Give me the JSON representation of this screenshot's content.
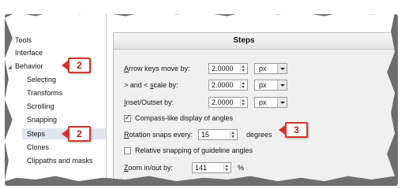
{
  "nav": {
    "items": [
      {
        "label": "Tools"
      },
      {
        "label": "Interface"
      },
      {
        "label": "Behavior"
      },
      {
        "label": "Selecting"
      },
      {
        "label": "Transforms"
      },
      {
        "label": "Scrolling"
      },
      {
        "label": "Snapping"
      },
      {
        "label": "Steps"
      },
      {
        "label": "Clones"
      },
      {
        "label": "Clippaths and masks"
      }
    ],
    "selected": "Steps",
    "expanded": "Behavior"
  },
  "page": {
    "title": "Steps",
    "arrow_keys": {
      "label_first": "A",
      "label_rest": "rrow keys move by:",
      "value": "2.0000",
      "unit": "px"
    },
    "scale": {
      "label_pre": "> and < ",
      "label_ul": "s",
      "label_post": "cale by:",
      "value": "2.0000",
      "unit": "px"
    },
    "inset": {
      "label_first": "I",
      "label_rest": "nset/Outset by:",
      "value": "2.0000",
      "unit": "px"
    },
    "compass": {
      "label": "Compass-like display of angles",
      "checked": true
    },
    "rotation": {
      "label_first": "R",
      "label_rest": "otation snaps every:",
      "value": "15",
      "unit": "degrees"
    },
    "relative": {
      "label": "Relative snapping of guideline angles",
      "checked": false
    },
    "zoom": {
      "label_first": "Z",
      "label_rest": "oom in/out by:",
      "value": "141",
      "unit": "%"
    }
  },
  "callouts": {
    "behavior": "2",
    "steps": "2",
    "rotation": "3"
  },
  "colors": {
    "callout_border": "#d8332b",
    "nav_selected_bg": "#dfe6ef",
    "panel_bg": "#f0f0f0"
  },
  "icons": {
    "checkbox": "check-icon",
    "expander": "triangle-expand-icon",
    "dropdown": "chevron-down-icon",
    "spinner": "spin-arrows-icon"
  }
}
